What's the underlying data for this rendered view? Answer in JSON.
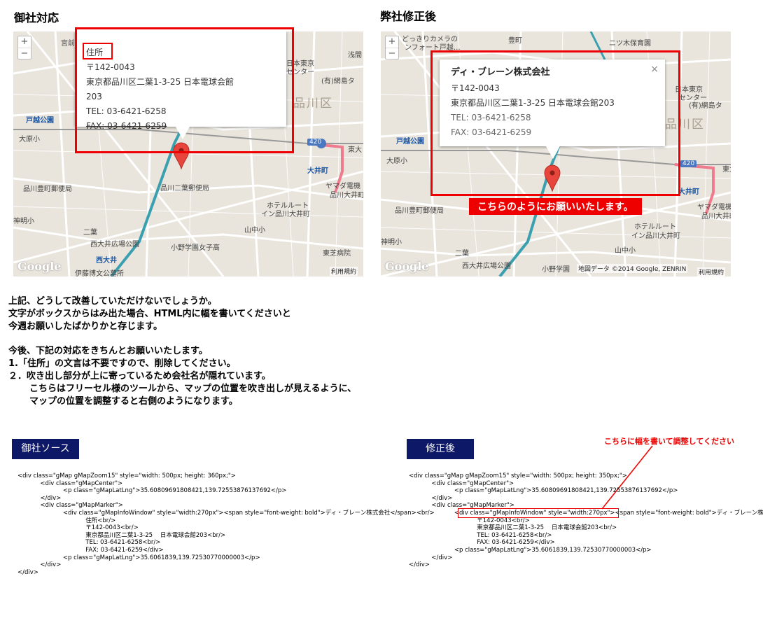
{
  "left": {
    "heading": "御社対応",
    "map": {
      "zoom_in": "+",
      "zoom_out": "−",
      "labels": [
        "宮前",
        "浅間",
        "戸越公園",
        "大原小",
        "品川豊町郵便局",
        "神明小",
        "二葉",
        "西大井広場公園",
        "西大井",
        "伊藤博文公墓所",
        "品川二葉郵便局",
        "小野学園女子高",
        "山中小",
        "東芝病院",
        "大井町",
        "ヤマダ電機",
        "品川大井町",
        "ホテルルート",
        "イン品川大井町",
        "東大",
        "日本東京",
        "センター",
        "(有)網島タ"
      ],
      "ward": "品川区",
      "route": "420",
      "google": "Google",
      "terms": "利用規約"
    },
    "info": {
      "line1": "住所",
      "line2": "〒142-0043",
      "line3": "東京都品川区二葉1-3-25  日本電球会館",
      "line4": "203",
      "line5": "TEL: 03-6421-6258",
      "line6": "FAX: 03-6421-6259"
    }
  },
  "right": {
    "heading": "弊社修正後",
    "map": {
      "zoom_in": "+",
      "zoom_out": "−",
      "labels": [
        "どっきりカメラの",
        "ンフォート戸越…",
        "豊町",
        "ニツ木保育園",
        "戸越公園",
        "大原小",
        "品川豊町郵便局",
        "神明小",
        "二葉",
        "西大井広場公園",
        "小野学園",
        "東大",
        "大井町",
        "ヤマダ電機",
        "品川大井町",
        "ホテルルート",
        "イン品川大井町",
        "山中小",
        "日本東京",
        "センター",
        "(有)網島タ"
      ],
      "ward": "品川区",
      "route": "420",
      "google": "Google",
      "attribution": "地図データ ©2014 Google, ZENRIN",
      "terms": "利用規約"
    },
    "info": {
      "title": "ディ・ブレーン株式会社",
      "close": "×",
      "line2": "〒142-0043",
      "line3": "東京都品川区二葉1-3-25  日本電球会館203",
      "line4": "TEL: 03-6421-6258",
      "line5": "FAX: 03-6421-6259"
    },
    "callout": "こちらのようにお願いいたします。"
  },
  "message": {
    "p1": [
      "上記、どうして改善していただけないでしょうか。",
      "文字がボックスからはみ出た場合、HTML内に幅を書いてくださいと",
      "今週お願いしたばかりかと存じます。"
    ],
    "p2": [
      "今後、下記の対応をきちんとお願いいたします。",
      "1.「住所」の文言は不要ですので、削除してください。",
      "２．吹き出し部分が上に寄っているため会社名が隠れています。"
    ],
    "p2_indent": [
      "こちらはフリーセル様のツールから、マップの位置を吹き出しが見えるように、",
      "マップの位置を調整すると右側のようになります。"
    ]
  },
  "source_left": {
    "tag": "御社ソース",
    "code": "<div class=\"gMap gMapZoom15\" style=\"width: 500px; height: 360px;\">\n            <div class=\"gMapCenter\">\n                        <p class=\"gMapLatLng\">35.60809691808421,139.72553876137692</p>\n            </div>\n            <div class=\"gMapMarker\">\n                        <div class=\"gMapInfoWindow\" style=\"width:270px\"><span style=\"font-weight: bold\">ディ・ブレーン株式会社</span><br/>\n                                    住所<br/>\n                                    〒142-0043<br/>\n                                    東京都品川区二葉1-3-25    日本電球会館203<br/>\n                                    TEL: 03-6421-6258<br/>\n                                    FAX: 03-6421-6259</div>\n                        <p class=\"gMapLatLng\">35.6061839,139.72530770000003</p>\n            </div>\n</div>"
  },
  "source_right": {
    "tag": "修正後",
    "note": "こちらに幅を書いて調整してください",
    "code": "<div class=\"gMap gMapZoom15\" style=\"width: 500px; height: 350px;\">\n            <div class=\"gMapCenter\">\n                        <p class=\"gMapLatLng\">35.60809691808421,139.72553876137692</p>\n            </div>\n            <div class=\"gMapMarker\">\n                        <div class=\"gMapInfoWindow\" style=\"width:270px\"><span style=\"font-weight: bold\">ディ・ブレーン株式会社</span><br/>\n                                    〒142-0043<br/>\n                                    東京都品川区二葉1-3-25    日本電球会館203<br/>\n                                    TEL: 03-6421-6258<br/>\n                                    FAX: 03-6421-6259</div>\n                        <p class=\"gMapLatLng\">35.6061839,139.72530770000003</p>\n            </div>\n</div>"
  }
}
